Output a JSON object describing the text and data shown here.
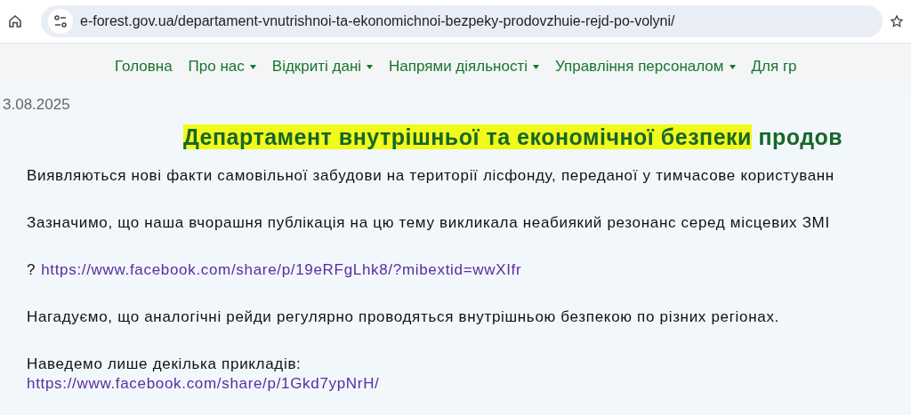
{
  "browser": {
    "url": "e-forest.gov.ua/departament-vnutrishnoi-ta-ekonomichnoi-bezpeky-prodovzhuie-rejd-po-volyni/"
  },
  "nav": [
    {
      "label": "Головна",
      "dropdown": false
    },
    {
      "label": "Про нас",
      "dropdown": true
    },
    {
      "label": "Відкриті дані",
      "dropdown": true
    },
    {
      "label": "Напрями діяльності",
      "dropdown": true
    },
    {
      "label": "Управління персоналом",
      "dropdown": true
    },
    {
      "label": "Для гр",
      "dropdown": false
    }
  ],
  "article": {
    "date": "3.08.2025",
    "title_highlighted": "Департамент внутрішньої та економічної безпеки",
    "title_rest": "продов",
    "blocks": [
      {
        "kind": "text",
        "text": "Виявляються нові факти самовільної забудови на території лісфонду, переданої у тимчасове користуванн"
      },
      {
        "kind": "text",
        "text": "Зазначимо, що наша вчорашня публікація на цю тему викликала неабиякий резонанс серед місцевих ЗМІ"
      },
      {
        "kind": "link",
        "prefix": "?",
        "text": "https://www.facebook.com/share/p/19eRFgLhk8/?mibextid=wwXIfr"
      },
      {
        "kind": "text",
        "text": "Нагадуємо, що аналогічні рейди регулярно проводяться внутрішньою безпекою по різних регіонах."
      },
      {
        "kind": "text",
        "text": "Наведемо лише декілька прикладів:"
      },
      {
        "kind": "link",
        "text": "https://www.facebook.com/share/p/1Gkd7ypNrH/"
      }
    ]
  }
}
